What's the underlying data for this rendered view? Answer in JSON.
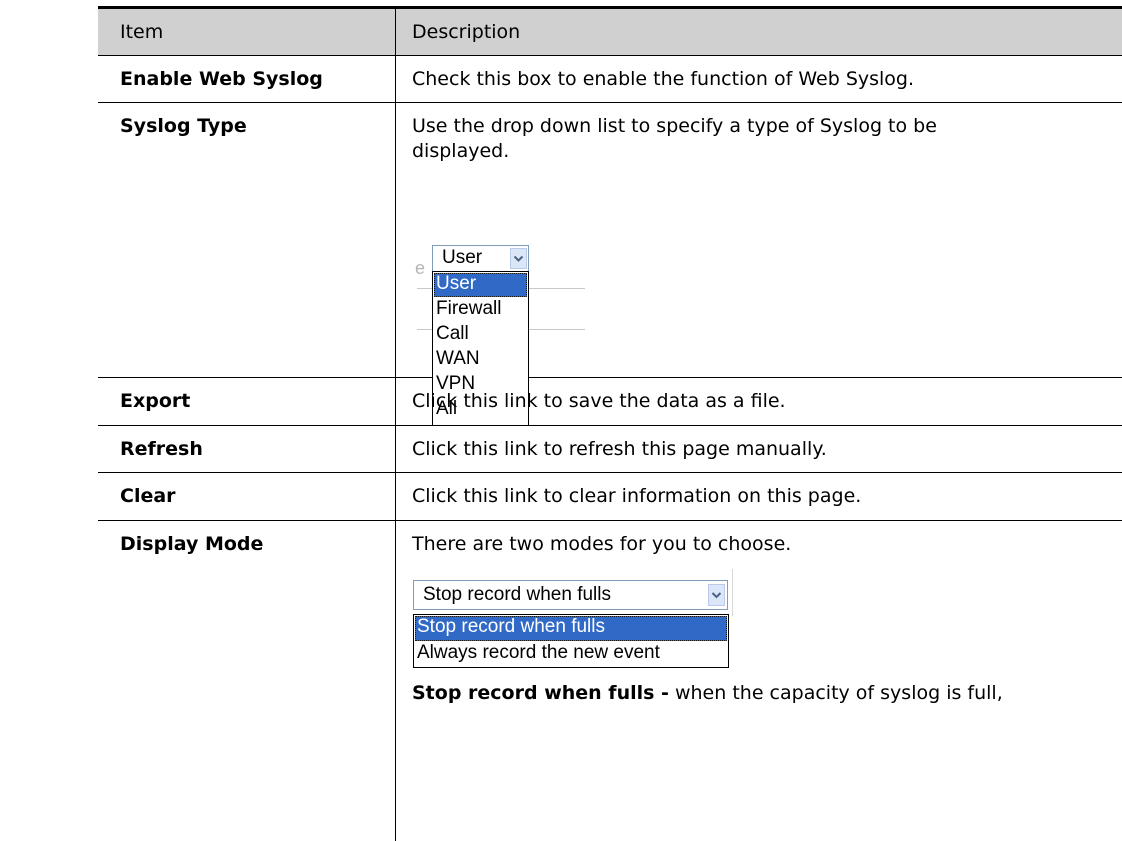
{
  "header": {
    "item": "Item",
    "description": "Description"
  },
  "rows": [
    {
      "item": "Enable Web Syslog",
      "description": "Check this box to enable the function of Web Syslog."
    },
    {
      "item": "Syslog Type",
      "description_line1": "Use the drop down list to specify a type of Syslog to be",
      "description_line2": "displayed."
    },
    {
      "item": "Export",
      "description": "Click this link to save the data as a file."
    },
    {
      "item": "Refresh",
      "description": "Click this link to refresh this page manually."
    },
    {
      "item": "Clear",
      "description": "Click this link to clear information on this page."
    },
    {
      "item": "Display Mode",
      "description": "There are two modes for you to choose.",
      "note_bold": "Stop record when fulls -",
      "note_text": " when the capacity of syslog is full,"
    }
  ],
  "syslog_type_dropdown": {
    "partial_label": "e",
    "selected": "User",
    "options": [
      "User",
      "Firewall",
      "Call",
      "WAN",
      "VPN",
      "All"
    ],
    "highlighted_index": 0,
    "arrow_icon": "chevron-down-icon"
  },
  "display_mode_dropdown": {
    "selected": "Stop record when fulls",
    "options": [
      "Stop record when fulls",
      "Always record the new event"
    ],
    "highlighted_index": 0,
    "arrow_icon": "chevron-down-icon"
  },
  "colors": {
    "header_bg": "#d0d0d0",
    "highlight": "#3169c6",
    "select_border": "#7f9db9"
  }
}
